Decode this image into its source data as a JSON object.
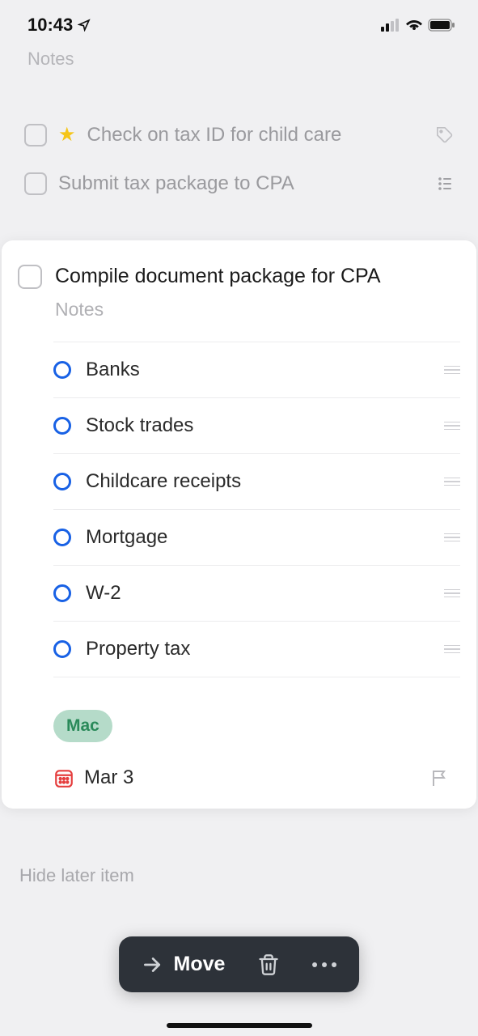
{
  "status": {
    "time": "10:43"
  },
  "partial_header": "Notes",
  "bg_tasks": [
    {
      "text": "Check on tax ID for child care",
      "has_star": true,
      "has_tag_icon": true
    },
    {
      "text": "Submit tax package to CPA",
      "has_list_icon": true
    }
  ],
  "task": {
    "title": "Compile document package for CPA",
    "notes_placeholder": "Notes",
    "subtasks": [
      "Banks",
      "Stock trades",
      "Childcare receipts",
      "Mortgage",
      "W-2",
      "Property tax"
    ],
    "tag": "Mac",
    "date": "Mar 3"
  },
  "hide_later": "Hide later item",
  "action_bar": {
    "move": "Move"
  }
}
